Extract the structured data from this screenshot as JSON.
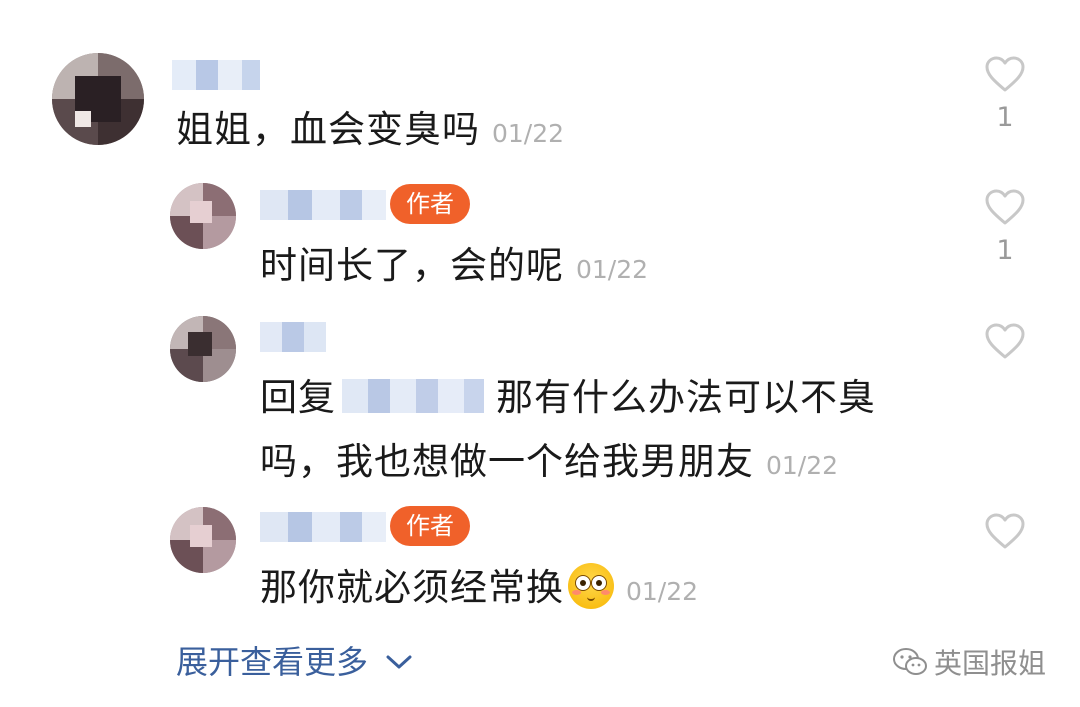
{
  "comments": [
    {
      "text": "姐姐，血会变臭吗",
      "time": "01/22",
      "likes": "1"
    },
    {
      "badge": "作者",
      "text": "时间长了，会的呢",
      "time": "01/22",
      "likes": "1"
    },
    {
      "reply_prefix": "回复",
      "text_line1": "那有什么办法可以不臭",
      "text_line2": "吗，我也想做一个给我男朋友",
      "time": "01/22"
    },
    {
      "badge": "作者",
      "text": "那你就必须经常换",
      "emoji": "flushed-face-emoji",
      "time": "01/22"
    }
  ],
  "footer": {
    "expand_label": "展开查看更多",
    "expand_icon": "chevron-down-icon",
    "watermark_icon": "wechat-icon",
    "watermark_text": "英国报姐"
  },
  "colors": {
    "badge": "#f0612a",
    "link": "#3a5f9c",
    "timestamp": "#b0b0b0",
    "heart_outline": "#c8c8c8"
  }
}
